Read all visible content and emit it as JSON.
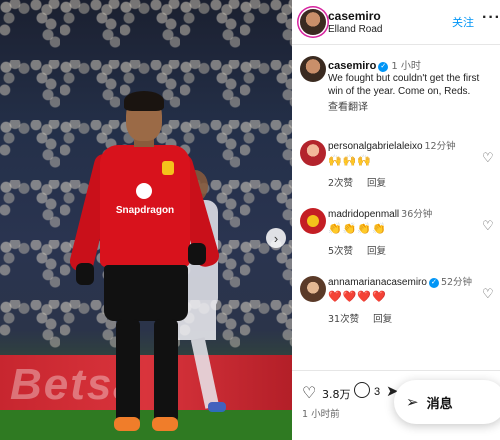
{
  "photo": {
    "banner_text": "Betsa",
    "sponsor": "Snapdragon",
    "next_icon": "chevron-right-icon"
  },
  "header": {
    "username": "casemiro",
    "location": "Elland Road",
    "follow_label": "关注",
    "more_icon": "more-icon"
  },
  "caption": {
    "username": "casemiro",
    "time": "1 小时",
    "text": "We fought but couldn't get the first win of the year. Come on, Reds.",
    "translate_label": "查看翻译"
  },
  "comments": [
    {
      "username": "personalgabrielaleixo",
      "time": "12分钟",
      "text": "🙌🙌🙌",
      "likes": "2次赞",
      "reply": "回复"
    },
    {
      "username": "madridopenmall",
      "time": "36分钟",
      "text": "👏👏👏👏",
      "likes": "5次赞",
      "reply": "回复"
    },
    {
      "username": "annamarianacasemiro",
      "time": "52分钟",
      "text": "❤️❤️❤️❤️",
      "likes": "31次赞",
      "reply": "回复",
      "verified": true
    }
  ],
  "actions": {
    "likes_count": "3.8万",
    "comments_count": "3",
    "post_time": "1 小时前"
  },
  "message_button": {
    "label": "消息"
  },
  "colors": {
    "accent": "#0095f6",
    "jersey": "#d8121c"
  }
}
